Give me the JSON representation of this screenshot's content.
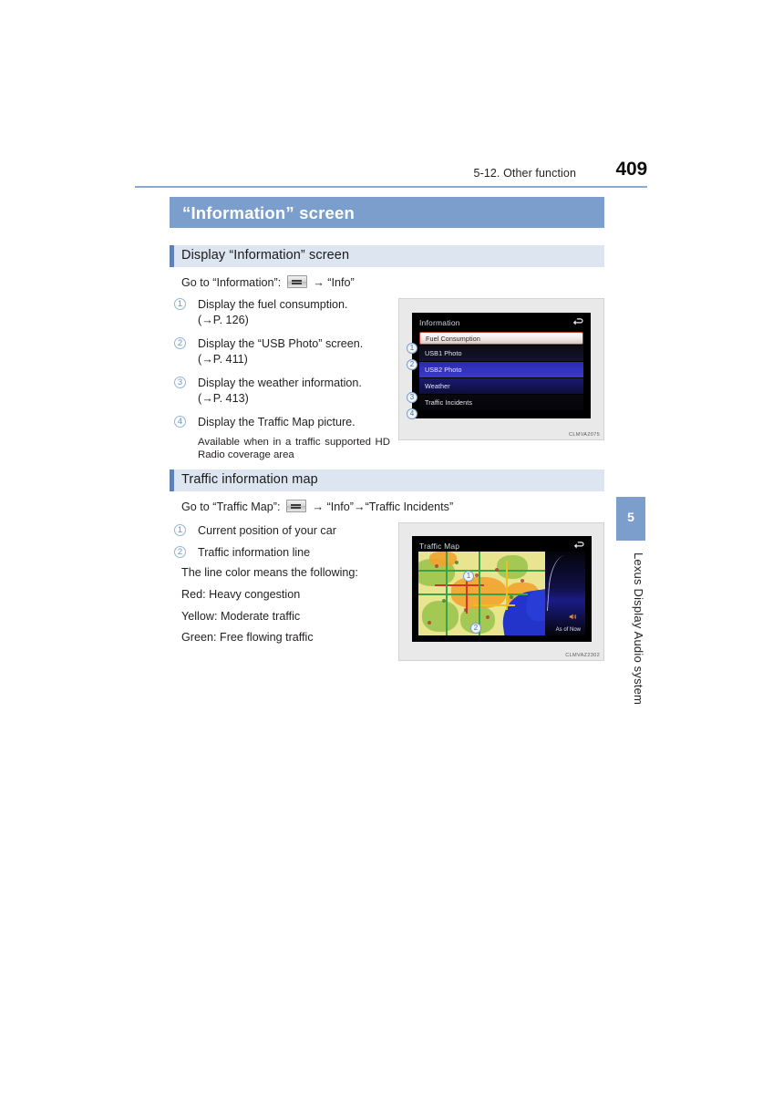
{
  "header": {
    "chapter": "5-12. Other function",
    "page_number": "409",
    "rule_color": "#8ca9cf"
  },
  "title_band": {
    "label": "“Information” screen",
    "background": "#7c9ecd",
    "text_color": "#ffffff"
  },
  "sections": [
    {
      "heading": "Display “Information” screen",
      "goto_prefix": "Go to “Information”:",
      "goto_suffix": "“Info”",
      "items": [
        {
          "num": "1",
          "text": "Display the fuel consumption.",
          "ref": "(→P. 126)"
        },
        {
          "num": "2",
          "text": "Display the “USB Photo” screen.",
          "ref": "(→P. 411)"
        },
        {
          "num": "3",
          "text": "Display the weather information.",
          "ref": "(→P. 413)"
        },
        {
          "num": "4",
          "text": "Display the Traffic Map picture.",
          "ref": ""
        }
      ],
      "note": "Available when in a traffic supported HD Radio coverage area"
    },
    {
      "heading": "Traffic information map",
      "goto_prefix": "Go to “Traffic Map”:",
      "goto_suffix": "“Info”→“Traffic Incidents”",
      "items": [
        {
          "num": "1",
          "text": "Current position of your car"
        },
        {
          "num": "2",
          "text": "Traffic information line"
        }
      ],
      "lines": [
        "The line color means the following:",
        "Red: Heavy congestion",
        "Yellow: Moderate traffic",
        "Green: Free flowing traffic"
      ]
    }
  ],
  "figure_information": {
    "screen_title": "Information",
    "figure_code": "CLMVA2075",
    "list": [
      {
        "label": "Fuel Consumption",
        "callout": "1",
        "selected": true
      },
      {
        "label": "USB1 Photo",
        "callout": "2",
        "selected": false
      },
      {
        "label": "USB2 Photo",
        "callout": "",
        "selected": false
      },
      {
        "label": "Weather",
        "callout": "3",
        "selected": false
      },
      {
        "label": "Traffic Incidents",
        "callout": "4",
        "selected": false
      }
    ]
  },
  "figure_traffic": {
    "screen_title": "Traffic Map",
    "figure_code": "CLMVAZ2302",
    "as_of_label": "As of Now",
    "callouts": [
      {
        "num": "1"
      },
      {
        "num": "2"
      }
    ]
  },
  "thumb_tab": {
    "number": "5",
    "label": "Lexus Display Audio system"
  },
  "icons": {
    "menu_key": "menu-hardkey-icon",
    "arrow": "→",
    "back": "back-arrow-icon",
    "speaker": "speaker-icon"
  }
}
